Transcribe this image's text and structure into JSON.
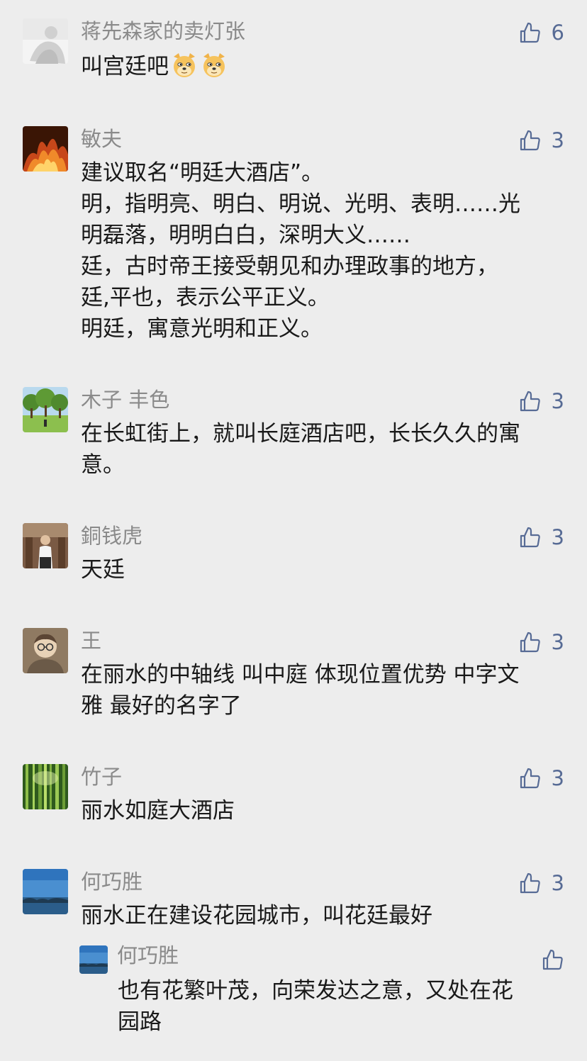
{
  "comments": [
    {
      "author": "蒋先森家的卖灯张",
      "likes": "6",
      "lines": [
        "叫宫廷吧"
      ],
      "emoji_icon": "doge-face-icon",
      "emoji_count": 2
    },
    {
      "author": "敏夫",
      "likes": "3",
      "lines": [
        "建议取名“明廷大酒店”。",
        "明，指明亮、明白、明说、光明、表明……光",
        "明磊落，明明白白，深明大义……",
        "廷，古时帝王接受朝见和办理政事的地方，",
        "廷,平也，表示公平正义。",
        "明廷，寓意光明和正义。"
      ]
    },
    {
      "author": "木子 丰色",
      "likes": "3",
      "lines": [
        "在长虹街上，就叫长庭酒店吧，长长久久的寓",
        "意。"
      ]
    },
    {
      "author": "銅钱虎",
      "likes": "3",
      "lines": [
        "天廷"
      ]
    },
    {
      "author": "王",
      "likes": "3",
      "lines": [
        "在丽水的中轴线 叫中庭 体现位置优势 中字文",
        "雅 最好的名字了"
      ]
    },
    {
      "author": "竹子",
      "likes": "3",
      "lines": [
        "丽水如庭大酒店"
      ]
    },
    {
      "author": "何巧胜",
      "likes": "3",
      "lines": [
        "丽水正在建设花园城市，叫花廷最好"
      ]
    }
  ],
  "reply": {
    "author": "何巧胜",
    "lines": [
      "也有花繁叶茂，向荣发达之意，又处在花",
      "园路"
    ]
  },
  "icons": {
    "like": "thumbs-up-icon"
  },
  "colors": {
    "background": "#ededed",
    "author": "#8a8a8a",
    "like": "#576b95",
    "text": "#191919"
  }
}
